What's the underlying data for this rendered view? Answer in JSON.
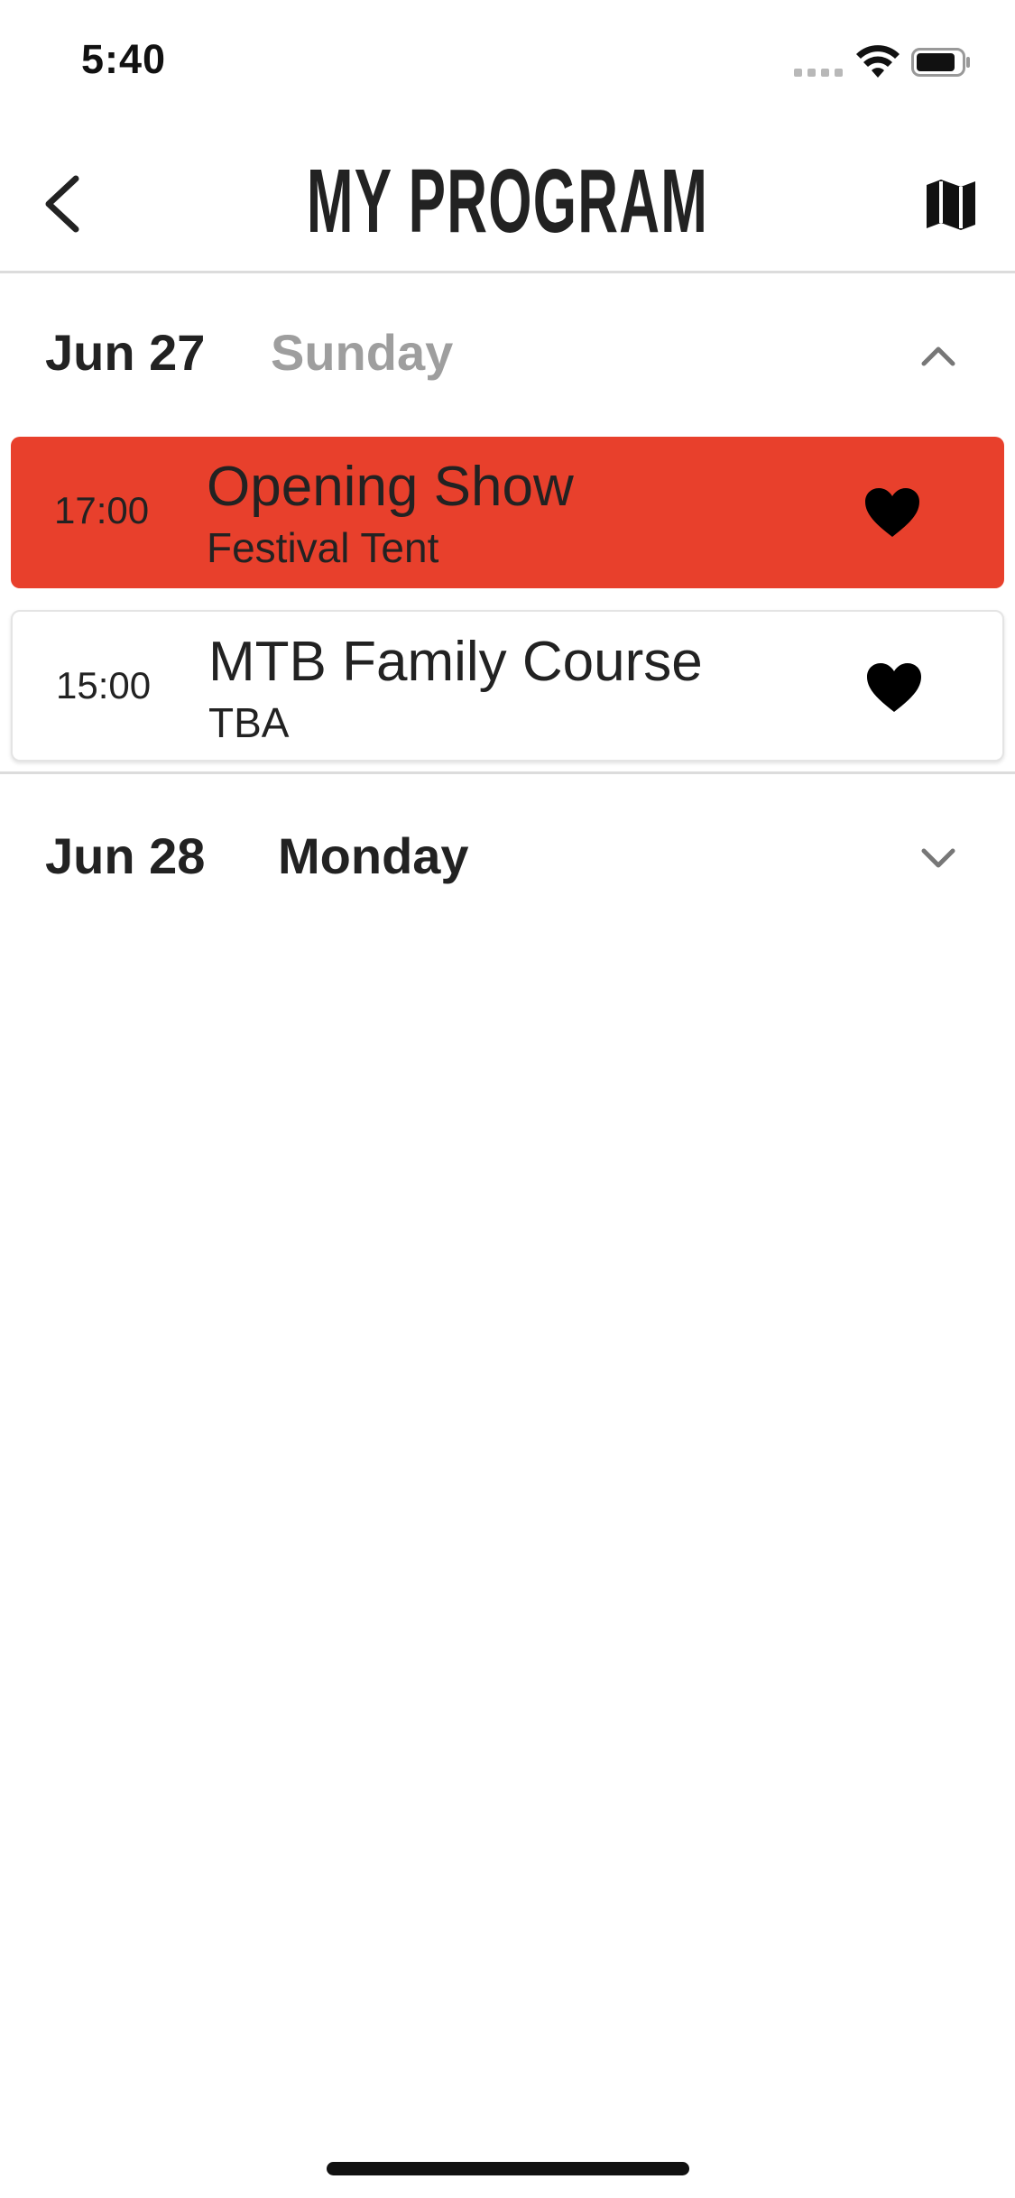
{
  "status_bar": {
    "time": "5:40"
  },
  "header": {
    "title": "MY PROGRAM",
    "back_icon": "chevron-left-icon",
    "map_icon": "map-icon"
  },
  "days": [
    {
      "date": "Jun 27",
      "weekday": "Sunday",
      "expanded": true,
      "weekday_color": "#9e9e9e",
      "events": [
        {
          "time": "17:00",
          "title": "Opening Show",
          "venue": "Festival Tent",
          "favorited": true,
          "highlighted": true
        },
        {
          "time": "15:00",
          "title": "MTB Family Course",
          "venue": "TBA",
          "favorited": true,
          "highlighted": false
        }
      ]
    },
    {
      "date": "Jun 28",
      "weekday": "Monday",
      "expanded": false,
      "weekday_color": "#222222",
      "events": []
    }
  ],
  "colors": {
    "accent": "#e8402c",
    "text": "#222222",
    "muted": "#9e9e9e",
    "divider": "#dcdcdc"
  }
}
